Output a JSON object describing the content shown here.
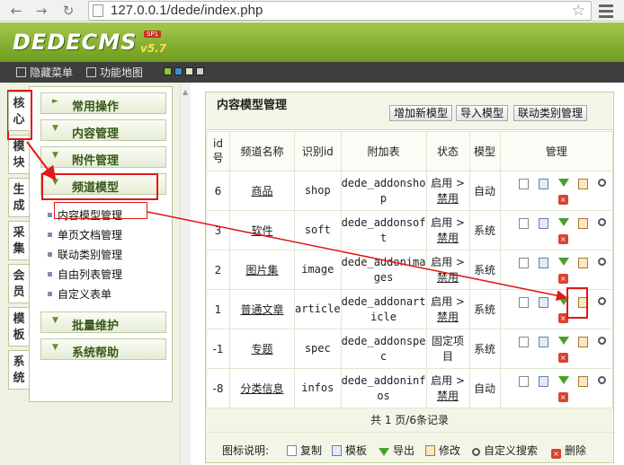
{
  "browser": {
    "url": "127.0.0.1/dede/index.php"
  },
  "header": {
    "logo_text": "DEDECMS",
    "logo_sp": "SP1",
    "logo_version": "v5.7"
  },
  "toolbar": {
    "hide_menu": "隐藏菜单",
    "feature_map": "功能地图",
    "swatches": [
      "#8fc23a",
      "#3e8ed0",
      "#d9e4b8",
      "#cfcfcf"
    ]
  },
  "vtabs": [
    "核心",
    "模块",
    "生成",
    "采集",
    "会员",
    "模板",
    "系统"
  ],
  "groups": {
    "common": "常用操作",
    "content": "内容管理",
    "attach": "附件管理",
    "channel": "频道模型",
    "batch": "批量维护",
    "help": "系统帮助"
  },
  "channel_items": [
    "内容模型管理",
    "单页文档管理",
    "联动类别管理",
    "自由列表管理",
    "自定义表单"
  ],
  "main": {
    "title": "内容模型管理",
    "buttons": {
      "add": "增加新模型",
      "import": "导入模型",
      "linkage": "联动类别管理"
    },
    "headers": {
      "id_top": "id",
      "id_bottom": "号",
      "name": "频道名称",
      "ident": "识别id",
      "addtable": "附加表",
      "status": "状态",
      "model": "模型",
      "manage": "管理"
    },
    "rows": [
      {
        "id": "6",
        "name": "商品",
        "ident": "shop",
        "table1": "dede_addonsho",
        "table2": "p",
        "status1": "启用 >",
        "status2": "禁用",
        "model": "自动"
      },
      {
        "id": "3",
        "name": "软件",
        "ident": "soft",
        "table1": "dede_addonsof",
        "table2": "t",
        "status1": "启用 >",
        "status2": "禁用",
        "model": "系统"
      },
      {
        "id": "2",
        "name": "图片集",
        "ident": "image",
        "table1": "dede_addonima",
        "table2": "ges",
        "status1": "启用 >",
        "status2": "禁用",
        "model": "系统"
      },
      {
        "id": "1",
        "name": "普通文章",
        "ident": "article",
        "table1": "dede_addonart",
        "table2": "icle",
        "status1": "启用 >",
        "status2": "禁用",
        "model": "系统"
      },
      {
        "id": "-1",
        "name": "专题",
        "ident": "spec",
        "table1": "dede_addonspe",
        "table2": "c",
        "status1": "固定项",
        "status2": "目",
        "model": "系统"
      },
      {
        "id": "-8",
        "name": "分类信息",
        "ident": "infos",
        "table1": "dede_addoninf",
        "table2": "os",
        "status1": "启用 >",
        "status2": "禁用",
        "model": "自动"
      }
    ],
    "pagination": "共 1 页/6条记录",
    "legend": {
      "label": "图标说明:",
      "copy": "复制",
      "template": "模板",
      "export": "导出",
      "edit": "修改",
      "search": "自定义搜索",
      "delete": "删除"
    }
  },
  "colors": {
    "annotation": "#e01818",
    "header_green": "#7da42a",
    "toolbar_dark": "#3e3e3e"
  }
}
